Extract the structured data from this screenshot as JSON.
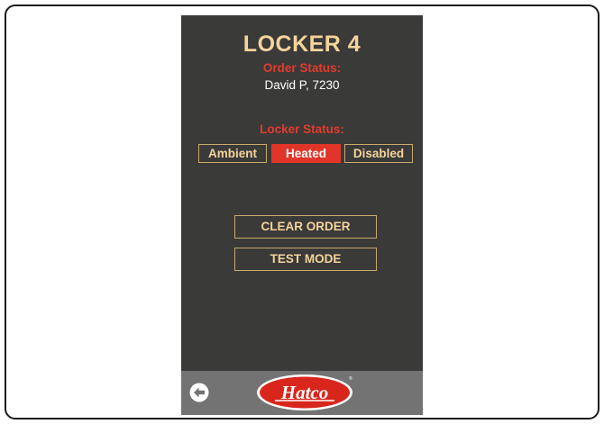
{
  "header": {
    "title": "LOCKER 4",
    "order_status_label": "Order Status:",
    "order_status_value": "David P, 7230"
  },
  "locker_status": {
    "label": "Locker Status:",
    "options": [
      "Ambient",
      "Heated",
      "Disabled"
    ],
    "selected": "Heated"
  },
  "actions": {
    "clear_order": "CLEAR ORDER",
    "test_mode": "TEST MODE"
  },
  "footer": {
    "back_icon": "back-arrow-circle-icon",
    "logo_text": "Hatco"
  },
  "colors": {
    "background": "#3a3a39",
    "accent_gold": "#f5d49b",
    "accent_red": "#e2352a",
    "footer": "#737373"
  }
}
